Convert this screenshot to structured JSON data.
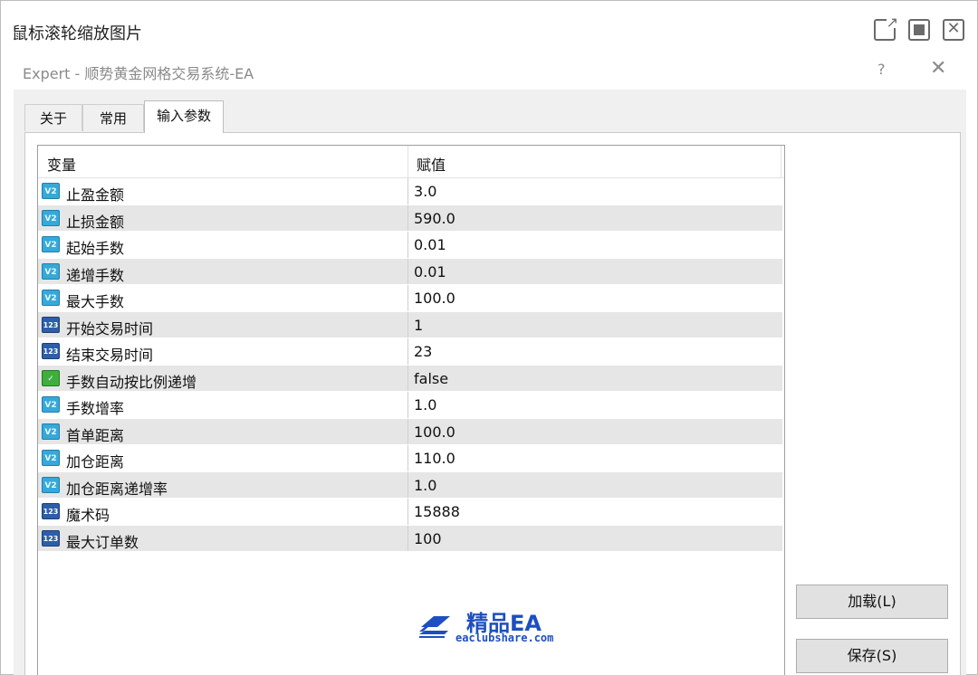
{
  "viewer": {
    "title": "鼠标滚轮缩放图片",
    "controls": [
      "open-external-icon",
      "maximize-icon",
      "close-icon"
    ]
  },
  "dialog": {
    "title": "Expert - 顺势黄金网格交易系统-EA",
    "help": "?",
    "close": "✕"
  },
  "tabs": [
    {
      "label": "关于",
      "active": false
    },
    {
      "label": "常用",
      "active": false
    },
    {
      "label": "输入参数",
      "active": true
    }
  ],
  "params": {
    "headers": [
      "变量",
      "赋值"
    ],
    "rows": [
      {
        "type": "double",
        "icon": "V2",
        "name": "止盈金额",
        "value": "3.0"
      },
      {
        "type": "double",
        "icon": "V2",
        "name": "止损金额",
        "value": "590.0"
      },
      {
        "type": "double",
        "icon": "V2",
        "name": "起始手数",
        "value": "0.01"
      },
      {
        "type": "double",
        "icon": "V2",
        "name": "递增手数",
        "value": "0.01"
      },
      {
        "type": "double",
        "icon": "V2",
        "name": "最大手数",
        "value": "100.0"
      },
      {
        "type": "int",
        "icon": "123",
        "name": "开始交易时间",
        "value": "1"
      },
      {
        "type": "int",
        "icon": "123",
        "name": "结束交易时间",
        "value": "23"
      },
      {
        "type": "bool",
        "icon": "✓",
        "name": "手数自动按比例递增",
        "value": "false"
      },
      {
        "type": "double",
        "icon": "V2",
        "name": "手数增率",
        "value": "1.0"
      },
      {
        "type": "double",
        "icon": "V2",
        "name": "首单距离",
        "value": "100.0"
      },
      {
        "type": "double",
        "icon": "V2",
        "name": "加仓距离",
        "value": "110.0"
      },
      {
        "type": "double",
        "icon": "V2",
        "name": "加仓距离递增率",
        "value": "1.0"
      },
      {
        "type": "int",
        "icon": "123",
        "name": "魔术码",
        "value": "15888"
      },
      {
        "type": "int",
        "icon": "123",
        "name": "最大订单数",
        "value": "100"
      }
    ]
  },
  "buttons": {
    "load": "加载(L)",
    "save": "保存(S)"
  },
  "watermark": {
    "brand": "精品EA",
    "site": "eaclubshare.com",
    "color": "#1d4fbf"
  }
}
